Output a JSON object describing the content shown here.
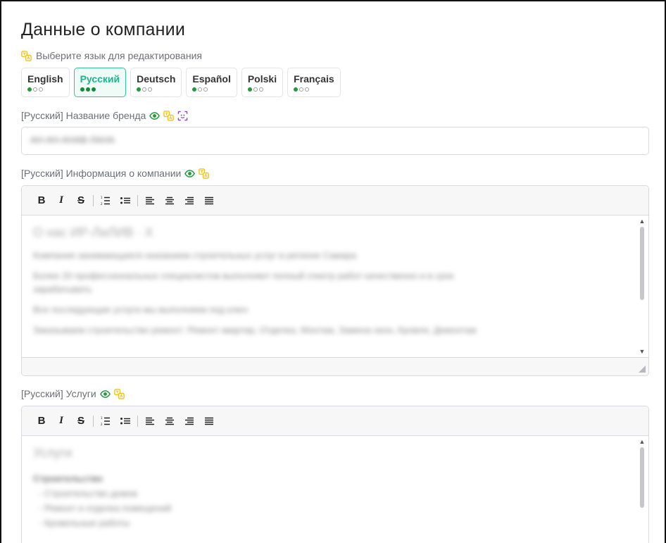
{
  "page": {
    "title": "Данные о компании"
  },
  "language_hint": "Выберите язык для редактирования",
  "languages": [
    {
      "name": "English",
      "filled": 1,
      "total": 3,
      "active": false
    },
    {
      "name": "Русский",
      "filled": 3,
      "total": 3,
      "active": true
    },
    {
      "name": "Deutsch",
      "filled": 1,
      "total": 3,
      "active": false
    },
    {
      "name": "Español",
      "filled": 1,
      "total": 3,
      "active": false
    },
    {
      "name": "Polski",
      "filled": 1,
      "total": 3,
      "active": false
    },
    {
      "name": "Français",
      "filled": 1,
      "total": 3,
      "active": false
    }
  ],
  "fields": {
    "brand_name": {
      "label": "[Русский] Название бренда",
      "value": "АН-АН-АНАВ-ЛАНА"
    },
    "company_info": {
      "label": "[Русский] Информация о компании",
      "lines": [
        "О нас ИР-ЛиЛИВ · Х",
        "Компания занимающаяся оказанием строительных услуг в регионе Самара",
        "Более 20 профессиональных специалистов выполняют полный спектр работ качественно и в срок",
        "зарабатывать",
        "Все последующие услуги мы выполняем под ключ",
        "Заказываем строительство ремонт: Ремонт квартир, Отделка, Монтаж, Замена окон, Кровля, Демонтаж"
      ]
    },
    "services": {
      "label": "[Русский] Услуги",
      "lines": [
        "Услуги",
        "Строительство",
        "- Строительство домов",
        "- Ремонт и отделка помещений",
        "- Кровельные работы"
      ]
    }
  },
  "toolbar": {
    "bold": "B",
    "italic": "I",
    "strike": "S"
  },
  "colors": {
    "accent": "#20b48a",
    "dot_filled": "#1f9b3a",
    "translate_icon": "#f2c21b",
    "ai_icon": "#8b3fc7",
    "eye_icon": "#1f9b3a"
  }
}
